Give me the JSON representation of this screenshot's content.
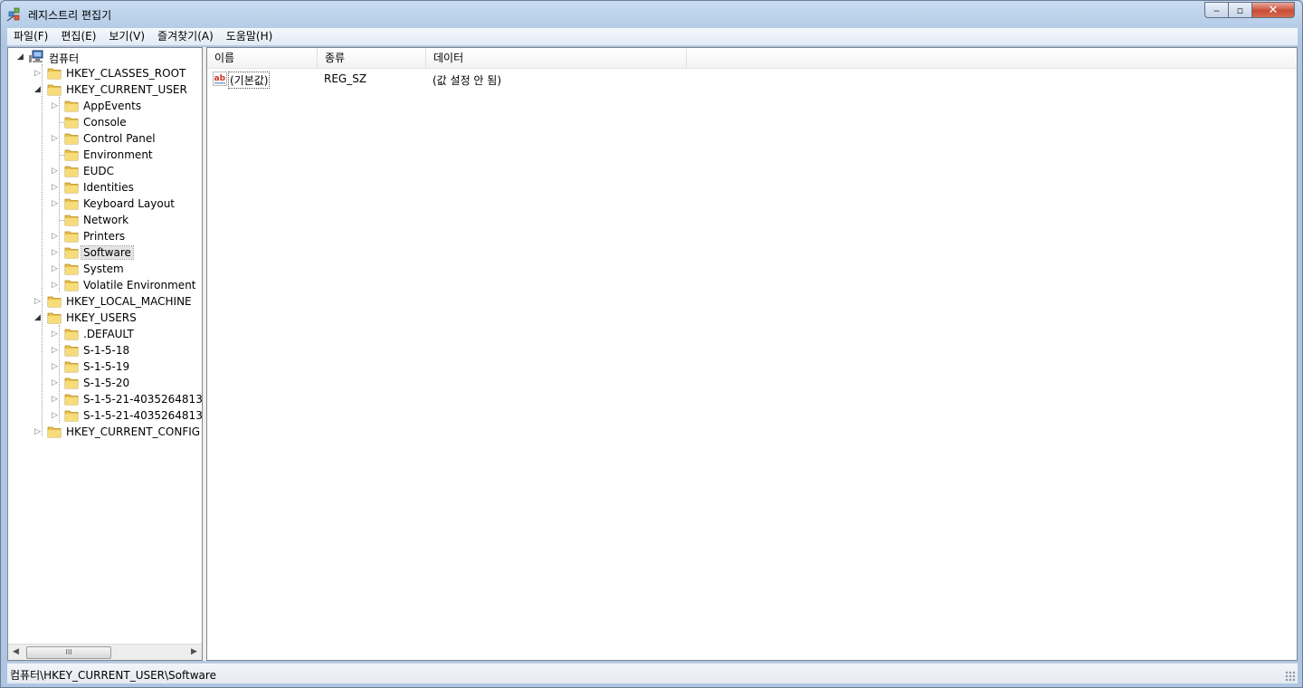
{
  "window": {
    "title": "레지스트리 편집기",
    "caption": {
      "minimize": "‒",
      "maximize": "▫",
      "close": "✕"
    }
  },
  "menubar": {
    "items": [
      "파일(F)",
      "편집(E)",
      "보기(V)",
      "즐겨찾기(A)",
      "도움말(H)"
    ]
  },
  "tree": {
    "root": "컴퓨터",
    "hives": {
      "classes_root": "HKEY_CLASSES_ROOT",
      "current_user": "HKEY_CURRENT_USER",
      "local_machine": "HKEY_LOCAL_MACHINE",
      "users": "HKEY_USERS",
      "current_config": "HKEY_CURRENT_CONFIG"
    },
    "current_user_children": [
      "AppEvents",
      "Console",
      "Control Panel",
      "Environment",
      "EUDC",
      "Identities",
      "Keyboard Layout",
      "Network",
      "Printers",
      "Software",
      "System",
      "Volatile Environment"
    ],
    "users_children": [
      ".DEFAULT",
      "S-1-5-18",
      "S-1-5-19",
      "S-1-5-20",
      "S-1-5-21-4035264813-",
      "S-1-5-21-4035264813-"
    ],
    "selected": "Software",
    "scrollbar_thumb": "III"
  },
  "list": {
    "columns": [
      "이름",
      "종류",
      "데이터"
    ],
    "rows": [
      {
        "name": "(기본값)",
        "type": "REG_SZ",
        "data": "(값 설정 안 됨)"
      }
    ]
  },
  "statusbar": {
    "path": "컴퓨터\\HKEY_CURRENT_USER\\Software"
  },
  "colors": {
    "title_bg": "#b9d0ea",
    "close_red": "#c94d36",
    "folder_yellow": "#f2d262"
  }
}
